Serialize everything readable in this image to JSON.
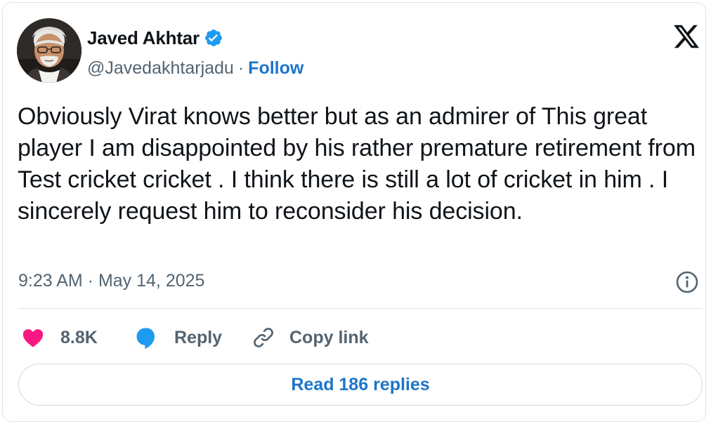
{
  "author": {
    "name": "Javed Akhtar",
    "handle": "@Javedakhtarjadu",
    "separator": "·",
    "follow_label": "Follow",
    "verified_icon": "verified-badge-icon"
  },
  "tweet": {
    "text": "Obviously Virat knows better but as an admirer of This great player I am disappointed by his rather premature retirement from Test cricket cricket . I think there is still a lot of cricket in him . I sincerely request him to reconsider his decision.",
    "timestamp": "9:23 AM · May 14, 2025"
  },
  "actions": {
    "like": {
      "icon": "heart-icon",
      "label": "8.8K"
    },
    "reply": {
      "icon": "speech-bubble-icon",
      "label": "Reply"
    },
    "copy": {
      "icon": "link-icon",
      "label": "Copy link"
    }
  },
  "read_replies_label": "Read 186 replies",
  "colors": {
    "link_blue": "#1d75c9",
    "verified_blue": "#1d9bf0",
    "like_pink": "#f91880",
    "secondary_text": "#536471",
    "primary_text": "#0f1419",
    "border": "#dfe3e6"
  }
}
